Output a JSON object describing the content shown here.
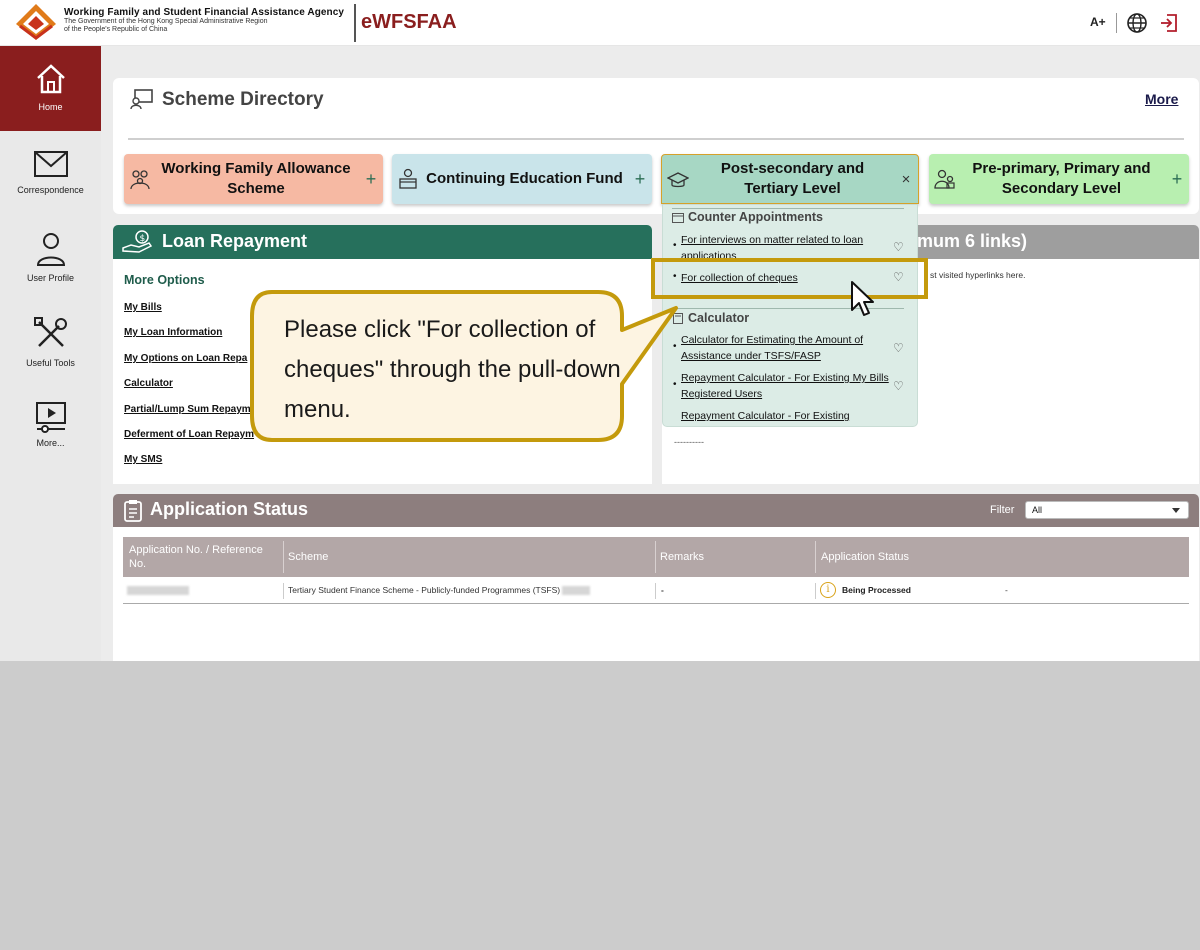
{
  "header": {
    "agency_name": "Working Family and Student Financial Assistance Agency",
    "gov_line1": "The Government of the Hong Kong Special Administrative Region",
    "gov_line2": "of the People's Republic of China",
    "brand": "eWFSFAA",
    "font_size_label": "A+",
    "icons": [
      "language-globe-icon",
      "logout-icon"
    ]
  },
  "sidebar": {
    "items": [
      {
        "label": "Home",
        "icon": "home-icon",
        "active": true
      },
      {
        "label": "Correspondence",
        "icon": "envelope-icon"
      },
      {
        "label": "User Profile",
        "icon": "user-icon"
      },
      {
        "label": "Useful Tools",
        "icon": "tools-icon"
      },
      {
        "label": "More...",
        "icon": "video-icon"
      }
    ]
  },
  "scheme_directory": {
    "title": "Scheme Directory",
    "more_label": "More",
    "tiles": [
      {
        "label": "Working Family Allowance Scheme",
        "toggle": "+",
        "color": "#f6b9a3"
      },
      {
        "label": "Continuing Education Fund",
        "toggle": "+",
        "color": "#c9e4ea"
      },
      {
        "label": "Post-secondary and Tertiary Level",
        "toggle": "×",
        "color": "#a7d7c4"
      },
      {
        "label": "Pre-primary, Primary and Secondary Level",
        "toggle": "+",
        "color": "#b8efb0"
      }
    ]
  },
  "dropdown": {
    "sections": [
      {
        "title": "Counter Appointments",
        "links": [
          "For interviews on matter related to loan applications",
          "For collection of cheques"
        ]
      },
      {
        "title": "Calculator",
        "links": [
          "Calculator for Estimating the Amount of Assistance under TSFS/FASP",
          "Repayment Calculator - For Existing My Bills Registered Users",
          "Repayment Calculator - For Existing"
        ]
      }
    ],
    "heart_symbol": "♡"
  },
  "loan_repayment": {
    "title": "Loan Repayment",
    "more_options": "More Options",
    "links": [
      "My Bills",
      "My Loan Information",
      "My Options on Loan Repa",
      "Calculator",
      "Partial/Lump Sum Repaym",
      "Deferment of Loan Repaym",
      "My SMS"
    ]
  },
  "favourites": {
    "title_fragment": "ximum 6 links)",
    "hint": "st visited hyperlinks here.",
    "placeholder": "----------"
  },
  "callout": {
    "text": "Please click \"For collection of cheques\" through the pull-down menu."
  },
  "application_status": {
    "title": "Application Status",
    "filter_label": "Filter",
    "filter_value": "All",
    "columns": [
      "Application No. / Reference No.",
      "Scheme",
      "Remarks",
      "Application Status"
    ],
    "rows": [
      {
        "scheme": "Tertiary Student Finance Scheme - Publicly-funded Programmes (TSFS)",
        "remarks": "-",
        "status": "Being Processed",
        "trailing": "-"
      }
    ]
  },
  "colors": {
    "brand_red": "#8a1e1e",
    "loan_green": "#26705c",
    "status_brown": "#8d7e7e",
    "highlight_gold": "#c49a0c"
  }
}
